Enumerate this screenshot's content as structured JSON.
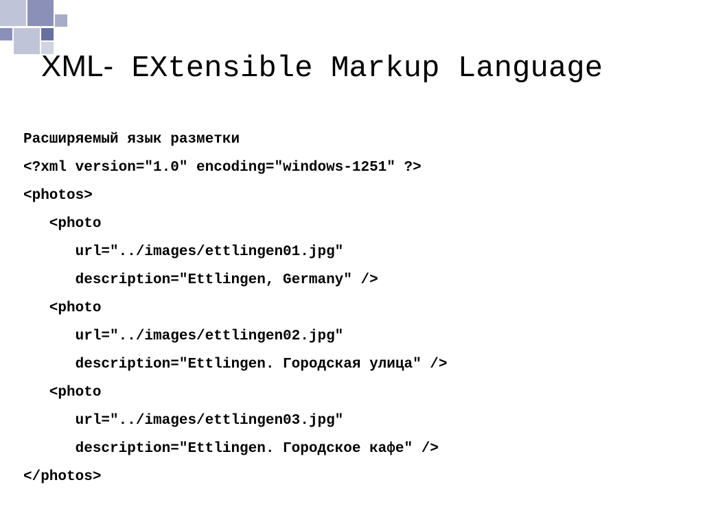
{
  "title": {
    "bold_part": "XML-",
    "mono_part": " EXtensible Markup Language"
  },
  "content": {
    "line1": "Расширяемый язык разметки",
    "line2": "<?xml version=\"1.0\" encoding=\"windows-1251\" ?>",
    "line3": "<photos>",
    "line4": "   <photo",
    "line5": "      url=\"../images/ettlingen01.jpg\"",
    "line6": "      description=\"Ettlingen, Germany\" />",
    "line7": "   <photo",
    "line8": "      url=\"../images/ettlingen02.jpg\"",
    "line9": "      description=\"Ettlingen. Городская улица\" />",
    "line10": "   <photo",
    "line11": "      url=\"../images/ettlingen03.jpg\"",
    "line12": "      description=\"Ettlingen. Городское кафе\" />",
    "line13": "</photos>"
  }
}
